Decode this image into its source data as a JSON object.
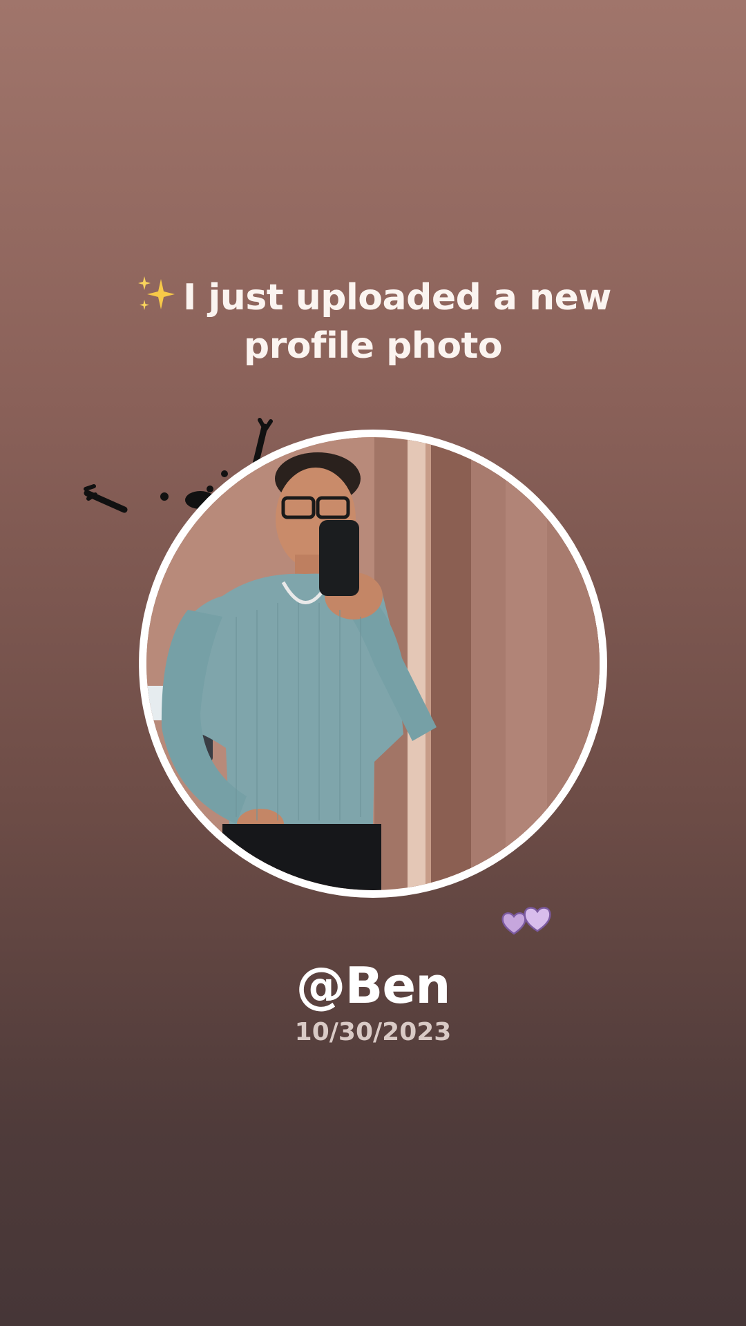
{
  "headline": {
    "line1": "I just uploaded a new",
    "line2": "profile photo",
    "icon": "sparkles-icon"
  },
  "profile": {
    "username": "@Ben",
    "date": "10/30/2023"
  },
  "decorations": {
    "doodle": "doodle-dots-icon",
    "hearts": "hearts-icon"
  },
  "colors": {
    "background_top": "#a0756b",
    "background_bottom": "#463637",
    "text": "#ffffff",
    "ring": "#ffffff",
    "sweater": "#7fa5ab"
  }
}
